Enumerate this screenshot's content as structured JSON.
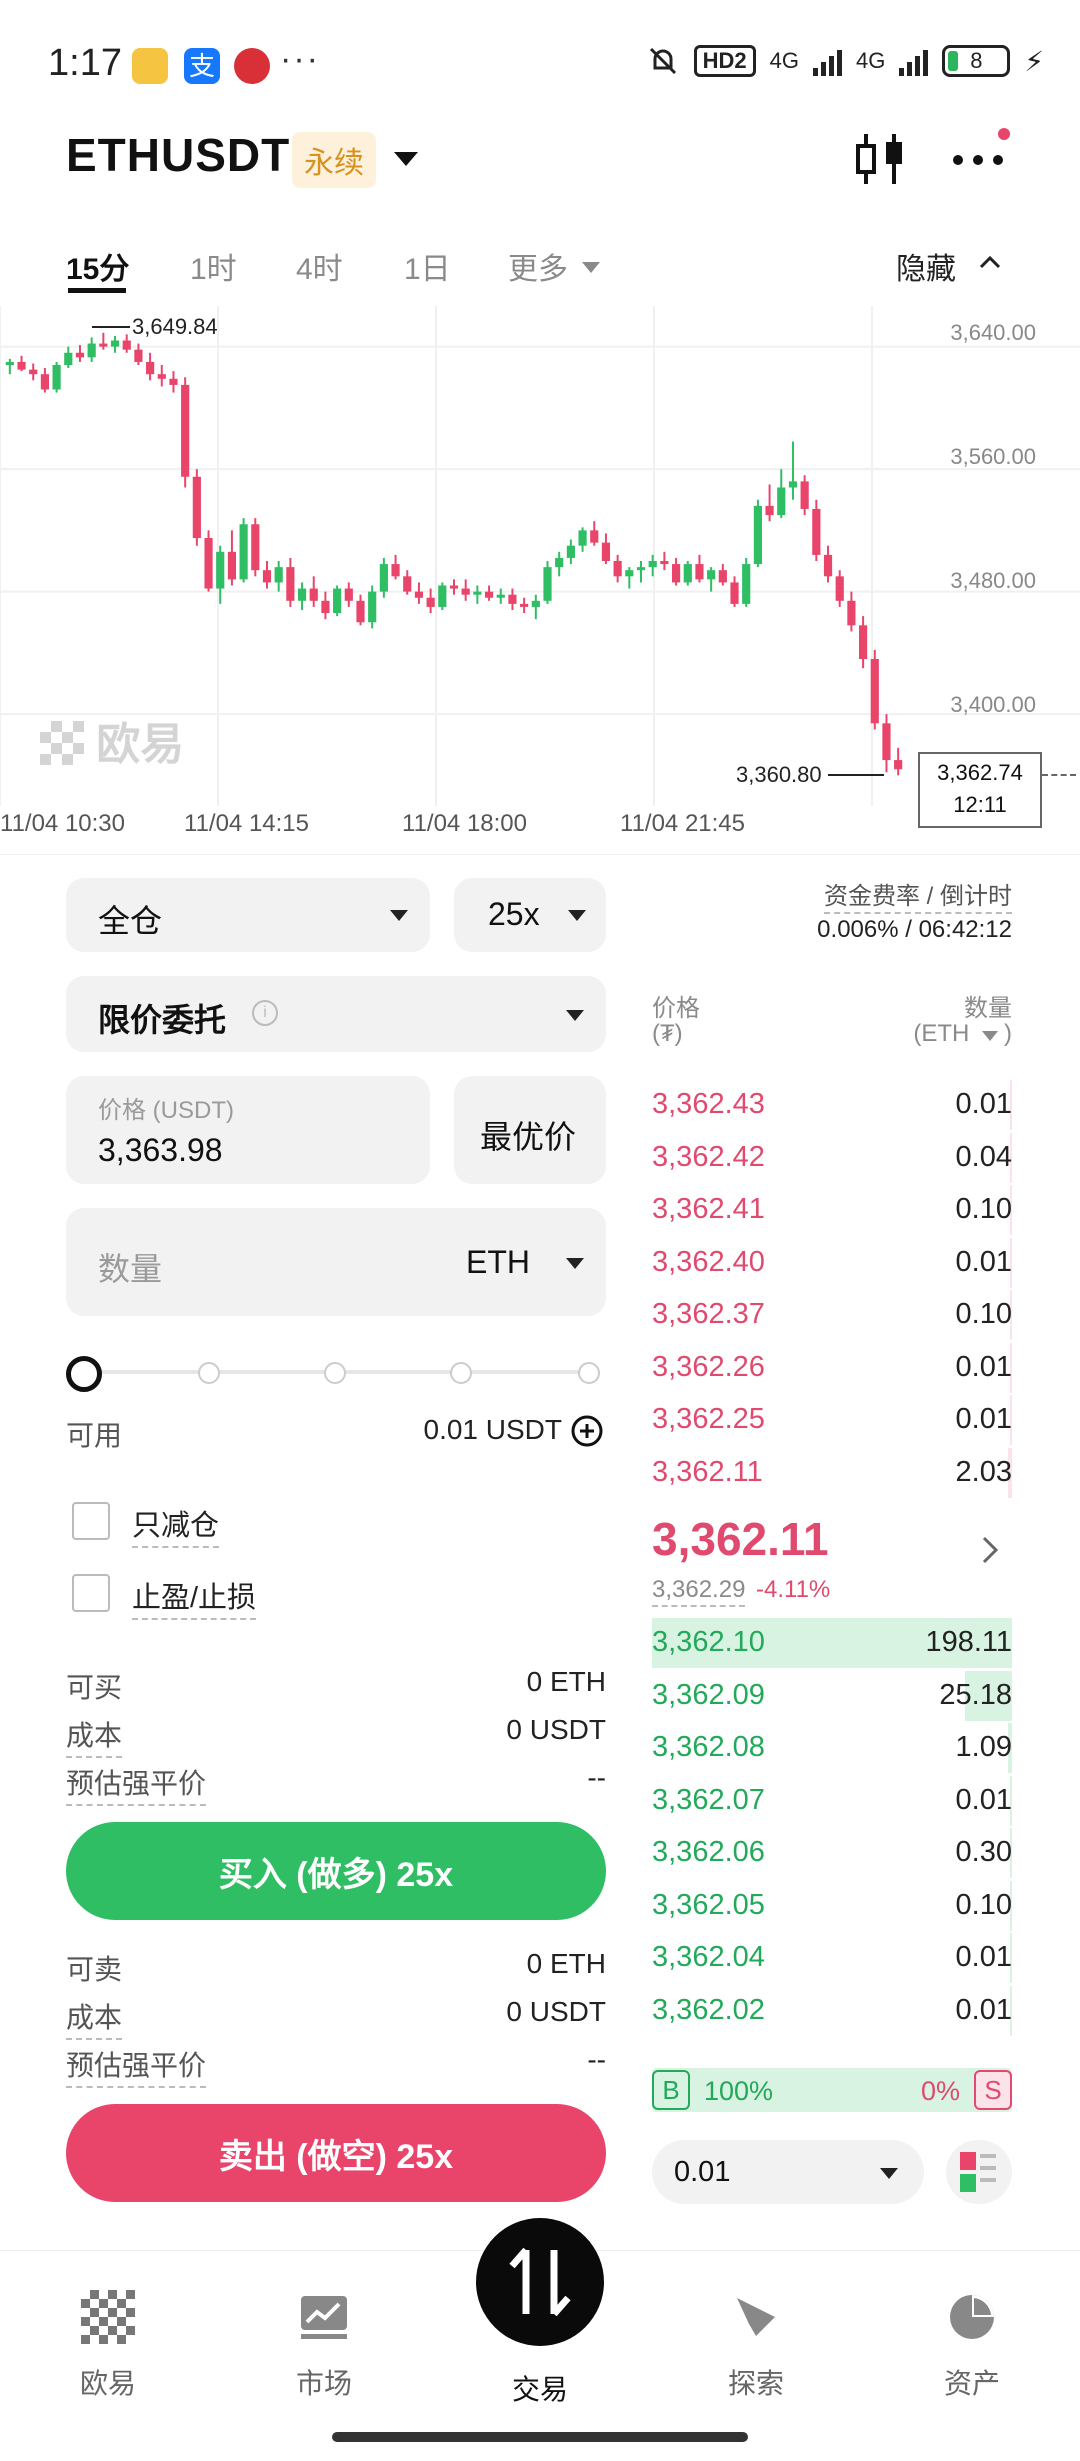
{
  "status": {
    "time": "1:17",
    "more": "···",
    "net1": "4G",
    "net2": "4G",
    "battery": "8",
    "hd": "HD2"
  },
  "header": {
    "symbol": "ETHUSDT",
    "tag": "永续"
  },
  "timeframes": [
    "15分",
    "1时",
    "4时",
    "1日",
    "更多"
  ],
  "hide_label": "隐藏",
  "chart_data": {
    "type": "candlestick",
    "y_ticks": [
      "3,640.00",
      "3,560.00",
      "3,480.00",
      "3,400.00"
    ],
    "x_ticks": [
      "11/04 10:30",
      "11/04 14:15",
      "11/04 18:00",
      "11/04 21:45"
    ],
    "high_label": "3,649.84",
    "low_label": "3,360.80",
    "last_price": "3,362.74",
    "countdown": "12:11",
    "watermark": "欧易",
    "ylim": [
      3340,
      3660
    ],
    "candles": [
      [
        3628,
        3632,
        3622,
        3630
      ],
      [
        3630,
        3634,
        3624,
        3625
      ],
      [
        3625,
        3629,
        3618,
        3622
      ],
      [
        3622,
        3626,
        3610,
        3612
      ],
      [
        3612,
        3630,
        3610,
        3628
      ],
      [
        3628,
        3640,
        3626,
        3636
      ],
      [
        3636,
        3641,
        3630,
        3633
      ],
      [
        3633,
        3646,
        3630,
        3642
      ],
      [
        3642,
        3649,
        3638,
        3640
      ],
      [
        3640,
        3647,
        3636,
        3644
      ],
      [
        3644,
        3648,
        3636,
        3638
      ],
      [
        3638,
        3642,
        3628,
        3630
      ],
      [
        3630,
        3636,
        3618,
        3622
      ],
      [
        3622,
        3628,
        3614,
        3619
      ],
      [
        3619,
        3624,
        3610,
        3615
      ],
      [
        3615,
        3620,
        3548,
        3555
      ],
      [
        3555,
        3560,
        3510,
        3515
      ],
      [
        3515,
        3520,
        3480,
        3482
      ],
      [
        3482,
        3510,
        3472,
        3506
      ],
      [
        3506,
        3520,
        3484,
        3488
      ],
      [
        3488,
        3528,
        3486,
        3524
      ],
      [
        3524,
        3528,
        3490,
        3494
      ],
      [
        3494,
        3500,
        3482,
        3486
      ],
      [
        3486,
        3500,
        3480,
        3496
      ],
      [
        3496,
        3502,
        3470,
        3474
      ],
      [
        3474,
        3486,
        3468,
        3482
      ],
      [
        3482,
        3490,
        3470,
        3474
      ],
      [
        3474,
        3480,
        3462,
        3466
      ],
      [
        3466,
        3484,
        3464,
        3482
      ],
      [
        3482,
        3486,
        3470,
        3474
      ],
      [
        3474,
        3478,
        3458,
        3460
      ],
      [
        3460,
        3484,
        3456,
        3480
      ],
      [
        3480,
        3502,
        3476,
        3498
      ],
      [
        3498,
        3504,
        3488,
        3490
      ],
      [
        3490,
        3494,
        3478,
        3480
      ],
      [
        3480,
        3486,
        3472,
        3476
      ],
      [
        3476,
        3482,
        3466,
        3470
      ],
      [
        3470,
        3486,
        3468,
        3484
      ],
      [
        3484,
        3488,
        3478,
        3482
      ],
      [
        3482,
        3488,
        3474,
        3478
      ],
      [
        3478,
        3484,
        3472,
        3480
      ],
      [
        3480,
        3484,
        3474,
        3476
      ],
      [
        3476,
        3482,
        3472,
        3478
      ],
      [
        3478,
        3482,
        3468,
        3472
      ],
      [
        3472,
        3476,
        3466,
        3470
      ],
      [
        3470,
        3478,
        3462,
        3474
      ],
      [
        3474,
        3500,
        3472,
        3496
      ],
      [
        3496,
        3506,
        3490,
        3502
      ],
      [
        3502,
        3514,
        3498,
        3510
      ],
      [
        3510,
        3522,
        3506,
        3520
      ],
      [
        3520,
        3526,
        3510,
        3512
      ],
      [
        3512,
        3518,
        3498,
        3500
      ],
      [
        3500,
        3504,
        3486,
        3490
      ],
      [
        3490,
        3496,
        3482,
        3494
      ],
      [
        3494,
        3500,
        3486,
        3496
      ],
      [
        3496,
        3504,
        3490,
        3500
      ],
      [
        3500,
        3506,
        3494,
        3498
      ],
      [
        3498,
        3502,
        3484,
        3486
      ],
      [
        3486,
        3500,
        3484,
        3498
      ],
      [
        3498,
        3504,
        3486,
        3488
      ],
      [
        3488,
        3496,
        3480,
        3494
      ],
      [
        3494,
        3498,
        3484,
        3486
      ],
      [
        3486,
        3490,
        3470,
        3472
      ],
      [
        3472,
        3502,
        3470,
        3498
      ],
      [
        3498,
        3540,
        3496,
        3536
      ],
      [
        3536,
        3550,
        3526,
        3530
      ],
      [
        3530,
        3560,
        3528,
        3548
      ],
      [
        3548,
        3578,
        3540,
        3552
      ],
      [
        3552,
        3556,
        3530,
        3534
      ],
      [
        3534,
        3540,
        3500,
        3504
      ],
      [
        3504,
        3510,
        3486,
        3490
      ],
      [
        3490,
        3494,
        3470,
        3474
      ],
      [
        3474,
        3480,
        3454,
        3458
      ],
      [
        3458,
        3464,
        3430,
        3436
      ],
      [
        3436,
        3442,
        3390,
        3394
      ],
      [
        3394,
        3400,
        3362,
        3370
      ],
      [
        3370,
        3378,
        3360,
        3364
      ]
    ]
  },
  "form": {
    "margin_mode": "全仓",
    "leverage": "25x",
    "order_type": "限价委托",
    "price_label": "价格 (USDT)",
    "price_value": "3,363.98",
    "best_price": "最优价",
    "qty_placeholder": "数量",
    "qty_unit": "ETH",
    "slider_percent": 0,
    "available_label": "可用",
    "available_value": "0.01 USDT",
    "reduce_only": "只减仓",
    "tp_sl": "止盈/止损",
    "buy_info": [
      {
        "label": "可买",
        "value": "0 ETH"
      },
      {
        "label": "成本",
        "value": "0 USDT"
      },
      {
        "label": "预估强平价",
        "value": "--"
      }
    ],
    "buy_button": "买入 (做多) 25x",
    "sell_info": [
      {
        "label": "可卖",
        "value": "0 ETH"
      },
      {
        "label": "成本",
        "value": "0 USDT"
      },
      {
        "label": "预估强平价",
        "value": "--"
      }
    ],
    "sell_button": "卖出 (做空) 25x"
  },
  "orderbook": {
    "funding_title": "资金费率 / 倒计时",
    "funding_value": "0.006% / 06:42:12",
    "price_header": "价格",
    "price_unit": "(₮)",
    "qty_header": "数量",
    "qty_unit": "(ETH",
    "asks": [
      {
        "price": "3,362.43",
        "qty": "0.01",
        "depth": 0.005
      },
      {
        "price": "3,362.42",
        "qty": "0.04",
        "depth": 0.005
      },
      {
        "price": "3,362.41",
        "qty": "0.10",
        "depth": 0.005
      },
      {
        "price": "3,362.40",
        "qty": "0.01",
        "depth": 0.005
      },
      {
        "price": "3,362.37",
        "qty": "0.10",
        "depth": 0.005
      },
      {
        "price": "3,362.26",
        "qty": "0.01",
        "depth": 0.005
      },
      {
        "price": "3,362.25",
        "qty": "0.01",
        "depth": 0.005
      },
      {
        "price": "3,362.11",
        "qty": "2.03",
        "depth": 0.01
      }
    ],
    "last_price": "3,362.11",
    "mark_price": "3,362.29",
    "change": "-4.11%",
    "bids": [
      {
        "price": "3,362.10",
        "qty": "198.11",
        "depth": 1.0
      },
      {
        "price": "3,362.09",
        "qty": "25.18",
        "depth": 0.13
      },
      {
        "price": "3,362.08",
        "qty": "1.09",
        "depth": 0.01
      },
      {
        "price": "3,362.07",
        "qty": "0.01",
        "depth": 0.005
      },
      {
        "price": "3,362.06",
        "qty": "0.30",
        "depth": 0.005
      },
      {
        "price": "3,362.05",
        "qty": "0.10",
        "depth": 0.005
      },
      {
        "price": "3,362.04",
        "qty": "0.01",
        "depth": 0.005
      },
      {
        "price": "3,362.02",
        "qty": "0.01",
        "depth": 0.005
      }
    ],
    "buy_ratio_label": "B",
    "buy_ratio": "100%",
    "sell_ratio": "0%",
    "sell_ratio_label": "S",
    "precision": "0.01"
  },
  "nav": [
    "欧易",
    "市场",
    "交易",
    "探索",
    "资产"
  ],
  "colors": {
    "up": "#2fbe63",
    "down": "#e9456b",
    "accent": "#d9911e"
  }
}
